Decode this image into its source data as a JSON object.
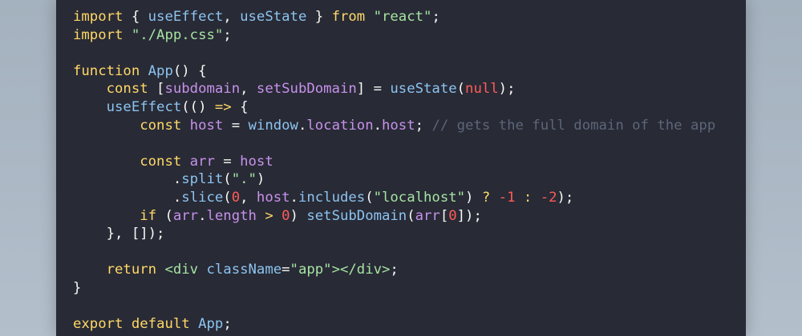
{
  "colors": {
    "background": "#a7b4c1",
    "editor_background": "#282a36",
    "keyword": "#ffd866",
    "identifier": "#8cc4ef",
    "string": "#a6e3a1",
    "variable": "#c792ea",
    "number": "#ff5c57",
    "comment": "#5c6678",
    "punctuation": "#f8f8f2"
  },
  "code_lines": [
    [
      {
        "t": "import",
        "k": "keyword"
      },
      {
        "t": " { ",
        "k": "punct"
      },
      {
        "t": "useEffect",
        "k": "ident"
      },
      {
        "t": ", ",
        "k": "punct"
      },
      {
        "t": "useState",
        "k": "ident"
      },
      {
        "t": " } ",
        "k": "punct"
      },
      {
        "t": "from",
        "k": "keyword"
      },
      {
        "t": " ",
        "k": "plain"
      },
      {
        "t": "\"react\"",
        "k": "string"
      },
      {
        "t": ";",
        "k": "punct"
      }
    ],
    [
      {
        "t": "import",
        "k": "keyword"
      },
      {
        "t": " ",
        "k": "plain"
      },
      {
        "t": "\"./App.css\"",
        "k": "string"
      },
      {
        "t": ";",
        "k": "punct"
      }
    ],
    [],
    [
      {
        "t": "function",
        "k": "keyword"
      },
      {
        "t": " ",
        "k": "plain"
      },
      {
        "t": "App",
        "k": "func"
      },
      {
        "t": "() {",
        "k": "punct"
      }
    ],
    [
      {
        "t": "    ",
        "k": "plain"
      },
      {
        "t": "const",
        "k": "keyword"
      },
      {
        "t": " [",
        "k": "punct"
      },
      {
        "t": "subdomain",
        "k": "variable"
      },
      {
        "t": ", ",
        "k": "punct"
      },
      {
        "t": "setSubDomain",
        "k": "variable"
      },
      {
        "t": "] = ",
        "k": "punct"
      },
      {
        "t": "useState",
        "k": "func"
      },
      {
        "t": "(",
        "k": "punct"
      },
      {
        "t": "null",
        "k": "literal"
      },
      {
        "t": ");",
        "k": "punct"
      }
    ],
    [
      {
        "t": "    ",
        "k": "plain"
      },
      {
        "t": "useEffect",
        "k": "func"
      },
      {
        "t": "(() ",
        "k": "punct"
      },
      {
        "t": "=>",
        "k": "operator"
      },
      {
        "t": " {",
        "k": "punct"
      }
    ],
    [
      {
        "t": "        ",
        "k": "plain"
      },
      {
        "t": "const",
        "k": "keyword"
      },
      {
        "t": " ",
        "k": "plain"
      },
      {
        "t": "host",
        "k": "variable"
      },
      {
        "t": " = ",
        "k": "punct"
      },
      {
        "t": "window",
        "k": "ident"
      },
      {
        "t": ".",
        "k": "punct"
      },
      {
        "t": "location",
        "k": "variable"
      },
      {
        "t": ".",
        "k": "punct"
      },
      {
        "t": "host",
        "k": "variable"
      },
      {
        "t": "; ",
        "k": "punct"
      },
      {
        "t": "// gets the full domain of the app",
        "k": "comment"
      }
    ],
    [],
    [
      {
        "t": "        ",
        "k": "plain"
      },
      {
        "t": "const",
        "k": "keyword"
      },
      {
        "t": " ",
        "k": "plain"
      },
      {
        "t": "arr",
        "k": "variable"
      },
      {
        "t": " = ",
        "k": "punct"
      },
      {
        "t": "host",
        "k": "variable"
      }
    ],
    [
      {
        "t": "            .",
        "k": "punct"
      },
      {
        "t": "split",
        "k": "func"
      },
      {
        "t": "(",
        "k": "punct"
      },
      {
        "t": "\".\"",
        "k": "string"
      },
      {
        "t": ")",
        "k": "punct"
      }
    ],
    [
      {
        "t": "            .",
        "k": "punct"
      },
      {
        "t": "slice",
        "k": "func"
      },
      {
        "t": "(",
        "k": "punct"
      },
      {
        "t": "0",
        "k": "number"
      },
      {
        "t": ", ",
        "k": "punct"
      },
      {
        "t": "host",
        "k": "variable"
      },
      {
        "t": ".",
        "k": "punct"
      },
      {
        "t": "includes",
        "k": "func"
      },
      {
        "t": "(",
        "k": "punct"
      },
      {
        "t": "\"localhost\"",
        "k": "string"
      },
      {
        "t": ") ",
        "k": "punct"
      },
      {
        "t": "?",
        "k": "operator"
      },
      {
        "t": " ",
        "k": "plain"
      },
      {
        "t": "-1",
        "k": "number"
      },
      {
        "t": " ",
        "k": "plain"
      },
      {
        "t": ":",
        "k": "operator"
      },
      {
        "t": " ",
        "k": "plain"
      },
      {
        "t": "-2",
        "k": "number"
      },
      {
        "t": ");",
        "k": "punct"
      }
    ],
    [
      {
        "t": "        ",
        "k": "plain"
      },
      {
        "t": "if",
        "k": "keyword"
      },
      {
        "t": " (",
        "k": "punct"
      },
      {
        "t": "arr",
        "k": "variable"
      },
      {
        "t": ".",
        "k": "punct"
      },
      {
        "t": "length",
        "k": "variable"
      },
      {
        "t": " ",
        "k": "plain"
      },
      {
        "t": ">",
        "k": "operator"
      },
      {
        "t": " ",
        "k": "plain"
      },
      {
        "t": "0",
        "k": "number"
      },
      {
        "t": ") ",
        "k": "punct"
      },
      {
        "t": "setSubDomain",
        "k": "func"
      },
      {
        "t": "(",
        "k": "punct"
      },
      {
        "t": "arr",
        "k": "variable"
      },
      {
        "t": "[",
        "k": "punct"
      },
      {
        "t": "0",
        "k": "number"
      },
      {
        "t": "]);",
        "k": "punct"
      }
    ],
    [
      {
        "t": "    }, []);",
        "k": "punct"
      }
    ],
    [],
    [
      {
        "t": "    ",
        "k": "plain"
      },
      {
        "t": "return",
        "k": "keyword"
      },
      {
        "t": " ",
        "k": "plain"
      },
      {
        "t": "<div",
        "k": "tag"
      },
      {
        "t": " ",
        "k": "plain"
      },
      {
        "t": "className",
        "k": "attr"
      },
      {
        "t": "=",
        "k": "punct"
      },
      {
        "t": "\"app\"",
        "k": "string"
      },
      {
        "t": "></div>",
        "k": "tag"
      },
      {
        "t": ";",
        "k": "punct"
      }
    ],
    [
      {
        "t": "}",
        "k": "punct"
      }
    ],
    [],
    [
      {
        "t": "export",
        "k": "keyword"
      },
      {
        "t": " ",
        "k": "plain"
      },
      {
        "t": "default",
        "k": "keyword"
      },
      {
        "t": " ",
        "k": "plain"
      },
      {
        "t": "App",
        "k": "ident"
      },
      {
        "t": ";",
        "k": "punct"
      }
    ]
  ]
}
